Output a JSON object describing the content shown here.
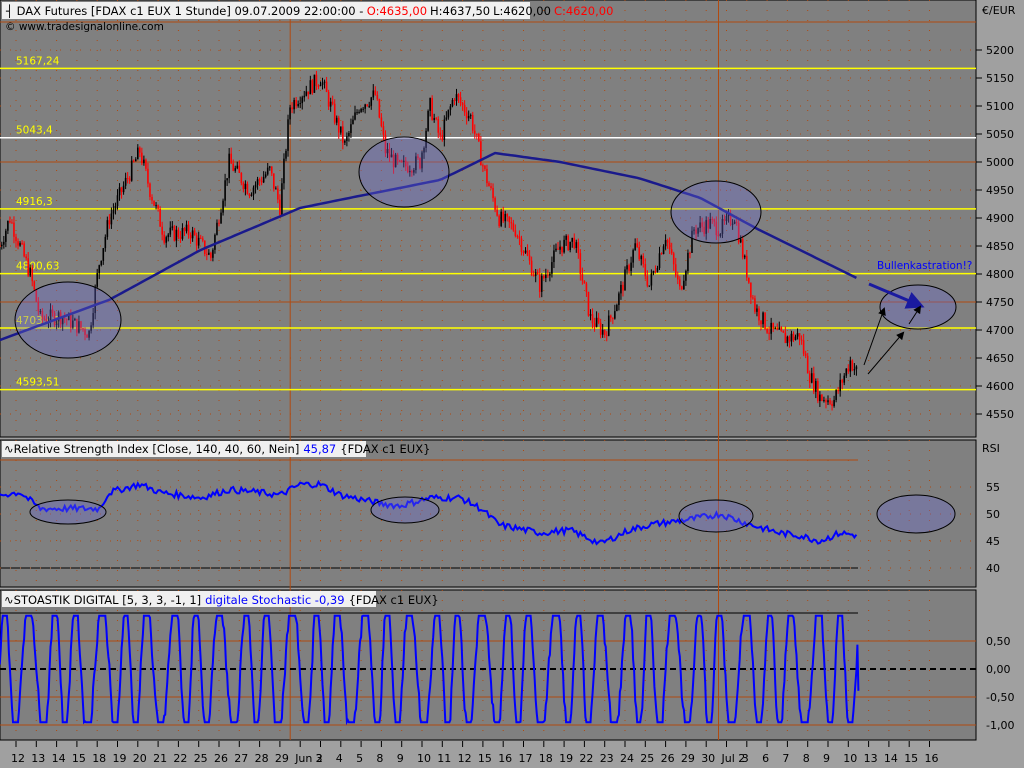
{
  "header": {
    "title": "DAX Futures [FDAX c1 EUX  1 Stunde] 09.07.2009 22:00:00 -",
    "open": "O:4635,00",
    "high": "H:4637,50",
    "low": "L:4620,00",
    "close": "C:4620,00",
    "copyright": "© www.tradesignalonline.com"
  },
  "price_axis": {
    "unit": "€/EUR",
    "ticks": [
      "5200",
      "5150",
      "5100",
      "5050",
      "5000",
      "4950",
      "4900",
      "4850",
      "4800",
      "4750",
      "4700",
      "4650",
      "4600",
      "4550"
    ]
  },
  "levels": [
    {
      "label": "5167,24",
      "value": 5167.24,
      "color": "#ffff00"
    },
    {
      "label": "5043,4",
      "value": 5043.4,
      "color": "#ffffff"
    },
    {
      "label": "4916,3",
      "value": 4916.3,
      "color": "#ffff00"
    },
    {
      "label": "4800,63",
      "value": 4800.63,
      "color": "#ffff00"
    },
    {
      "label": "4703,46",
      "value": 4703.46,
      "color": "#ffff00"
    },
    {
      "label": "4593,51",
      "value": 4593.51,
      "color": "#ffff00"
    }
  ],
  "annotation": "Bullenkastration!?",
  "rsi": {
    "title": "Relative Strength Index [Close, 140, 40, 60, Nein]",
    "value": "45,87",
    "symbol": "{FDAX c1 EUX}",
    "axis_label": "RSI",
    "ticks": [
      "55",
      "50",
      "45",
      "40"
    ]
  },
  "stoch": {
    "title": "STOASTIK DIGITAL [5, 3, 3, -1, 1]",
    "value": "digitale Stochastic -0,39",
    "symbol": "{FDAX c1 EUX}",
    "ticks": [
      "0,50",
      "0,00",
      "-0,50",
      "-1,00"
    ],
    "last": -0.39
  },
  "dates": [
    "12",
    "13",
    "14",
    "15",
    "18",
    "19",
    "20",
    "21",
    "22",
    "25",
    "26",
    "27",
    "28",
    "29",
    "Jun 2",
    "3",
    "4",
    "5",
    "8",
    "9",
    "10",
    "11",
    "12",
    "15",
    "16",
    "17",
    "18",
    "19",
    "22",
    "23",
    "24",
    "25",
    "26",
    "29",
    "30",
    "Jul 2",
    "3",
    "6",
    "7",
    "8",
    "9",
    "10",
    "13",
    "14",
    "15",
    "16"
  ],
  "colors": {
    "background": "#808080",
    "up": "#000000",
    "down": "#ff0000",
    "ma": "#1a1a8c",
    "rsi": "#0000ff",
    "stoch": "#0000ff",
    "grid": "#b04a10"
  },
  "chart_data": {
    "type": "candlestick",
    "title": "DAX Futures 1 Stunde",
    "ylim": [
      4530,
      5260
    ],
    "price_path": [
      [
        -0.8,
        4850
      ],
      [
        -0.3,
        4900
      ],
      [
        0.7,
        4800
      ],
      [
        1.2,
        4720
      ],
      [
        2.2,
        4725
      ],
      [
        3.6,
        4695
      ],
      [
        4.1,
        4820
      ],
      [
        4.6,
        4900
      ],
      [
        6.1,
        5020
      ],
      [
        6.6,
        4950
      ],
      [
        7.3,
        4870
      ],
      [
        8.6,
        4875
      ],
      [
        9.6,
        4830
      ],
      [
        10.5,
        5000
      ],
      [
        11.5,
        4950
      ],
      [
        12.5,
        4985
      ],
      [
        13.0,
        4920
      ],
      [
        13.5,
        5100
      ],
      [
        14.0,
        5120
      ],
      [
        15.0,
        5150
      ],
      [
        15.7,
        5080
      ],
      [
        16.2,
        5030
      ],
      [
        16.9,
        5100
      ],
      [
        17.7,
        5120
      ],
      [
        18.2,
        5020
      ],
      [
        18.9,
        4990
      ],
      [
        19.9,
        5000
      ],
      [
        20.4,
        5100
      ],
      [
        20.9,
        5040
      ],
      [
        21.6,
        5120
      ],
      [
        22.4,
        5080
      ],
      [
        23.1,
        4980
      ],
      [
        23.8,
        4900
      ],
      [
        24.6,
        4880
      ],
      [
        25.3,
        4820
      ],
      [
        25.8,
        4780
      ],
      [
        26.8,
        4850
      ],
      [
        27.5,
        4860
      ],
      [
        28.3,
        4720
      ],
      [
        29.0,
        4695
      ],
      [
        29.7,
        4760
      ],
      [
        30.5,
        4850
      ],
      [
        31.2,
        4780
      ],
      [
        32.0,
        4870
      ],
      [
        32.7,
        4770
      ],
      [
        33.4,
        4880
      ],
      [
        34.2,
        4890
      ],
      [
        34.7,
        4880
      ],
      [
        35.4,
        4905
      ],
      [
        35.9,
        4820
      ],
      [
        36.4,
        4740
      ],
      [
        37.1,
        4700
      ],
      [
        37.9,
        4685
      ],
      [
        38.6,
        4690
      ],
      [
        39.1,
        4620
      ],
      [
        39.6,
        4580
      ],
      [
        40.3,
        4575
      ],
      [
        41.1,
        4645
      ],
      [
        41.5,
        4620
      ]
    ],
    "moving_average": [
      [
        -0.8,
        4682
      ],
      [
        4.6,
        4754
      ],
      [
        9.1,
        4843
      ],
      [
        14.0,
        4918
      ],
      [
        17.0,
        4940
      ],
      [
        20.9,
        4968
      ],
      [
        23.6,
        5016
      ],
      [
        26.8,
        5000
      ],
      [
        30.7,
        4971
      ],
      [
        33.7,
        4936
      ],
      [
        36.6,
        4879
      ],
      [
        41.4,
        4793
      ]
    ],
    "rsi_path": [
      [
        -0.8,
        53.5
      ],
      [
        0.2,
        54
      ],
      [
        1.2,
        51
      ],
      [
        4.1,
        51
      ],
      [
        4.6,
        54
      ],
      [
        6.1,
        55.5
      ],
      [
        7.1,
        54
      ],
      [
        9.1,
        53
      ],
      [
        10.5,
        54.5
      ],
      [
        12.0,
        54
      ],
      [
        13.0,
        53.5
      ],
      [
        14.0,
        55.5
      ],
      [
        15.0,
        55.5
      ],
      [
        16.0,
        53.5
      ],
      [
        17.9,
        52
      ],
      [
        18.9,
        51.5
      ],
      [
        20.4,
        53
      ],
      [
        21.9,
        53
      ],
      [
        22.9,
        51
      ],
      [
        23.8,
        48
      ],
      [
        25.8,
        46.5
      ],
      [
        27.3,
        47
      ],
      [
        28.8,
        44.5
      ],
      [
        30.2,
        47
      ],
      [
        31.2,
        48
      ],
      [
        33.2,
        49
      ],
      [
        34.7,
        50
      ],
      [
        36.2,
        48
      ],
      [
        37.6,
        46.5
      ],
      [
        38.6,
        46
      ],
      [
        39.6,
        45
      ],
      [
        40.6,
        46.5
      ],
      [
        41.5,
        46
      ]
    ],
    "stoch_cycles": 36,
    "stoch_range": [
      -0.95,
      0.95
    ]
  }
}
